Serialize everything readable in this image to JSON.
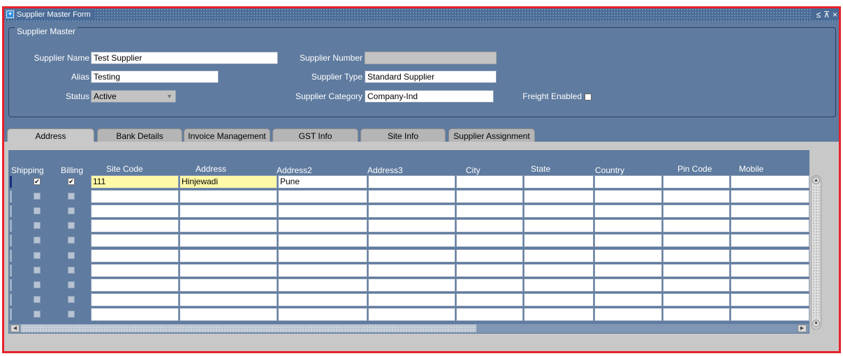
{
  "window": {
    "title": "Supplier Master Form",
    "controls": [
      "≤",
      "⊼",
      "×"
    ]
  },
  "supplier_master": {
    "legend": "Supplier Master",
    "fields": {
      "supplier_name": {
        "label": "Supplier Name",
        "value": "Test Supplier"
      },
      "alias": {
        "label": "Alias",
        "value": "Testing"
      },
      "status": {
        "label": "Status",
        "value": "Active"
      },
      "supplier_number": {
        "label": "Supplier Number",
        "value": ""
      },
      "supplier_type": {
        "label": "Supplier Type",
        "value": "Standard Supplier"
      },
      "supplier_category": {
        "label": "Supplier Category",
        "value": "Company-Ind"
      },
      "freight_enabled": {
        "label": "Freight Enabled",
        "checked": false
      }
    }
  },
  "tabs": [
    {
      "label": "Address",
      "active": true
    },
    {
      "label": "Bank Details",
      "active": false
    },
    {
      "label": "Invoice Management",
      "active": false
    },
    {
      "label": "GST Info",
      "active": false
    },
    {
      "label": "Site Info",
      "active": false
    },
    {
      "label": "Supplier Assignment",
      "active": false
    }
  ],
  "address_grid": {
    "columns": {
      "shipping": "Shipping",
      "billing": "Billing",
      "site_code": "Site Code",
      "address": "Address",
      "address2": "Address2",
      "address3": "Address3",
      "city": "City",
      "state": "State",
      "country": "Country",
      "pin_code": "Pin Code",
      "mobile": "Mobile"
    },
    "rows": [
      {
        "shipping": true,
        "billing": true,
        "site_code": "111",
        "address": "Hinjewadi",
        "address2": "Pune",
        "address3": "",
        "city": "",
        "state": "",
        "country": "",
        "pin_code": "",
        "mobile": ""
      },
      {
        "shipping": false,
        "billing": false,
        "site_code": "",
        "address": "",
        "address2": "",
        "address3": "",
        "city": "",
        "state": "",
        "country": "",
        "pin_code": "",
        "mobile": ""
      },
      {
        "shipping": false,
        "billing": false,
        "site_code": "",
        "address": "",
        "address2": "",
        "address3": "",
        "city": "",
        "state": "",
        "country": "",
        "pin_code": "",
        "mobile": ""
      },
      {
        "shipping": false,
        "billing": false,
        "site_code": "",
        "address": "",
        "address2": "",
        "address3": "",
        "city": "",
        "state": "",
        "country": "",
        "pin_code": "",
        "mobile": ""
      },
      {
        "shipping": false,
        "billing": false,
        "site_code": "",
        "address": "",
        "address2": "",
        "address3": "",
        "city": "",
        "state": "",
        "country": "",
        "pin_code": "",
        "mobile": ""
      },
      {
        "shipping": false,
        "billing": false,
        "site_code": "",
        "address": "",
        "address2": "",
        "address3": "",
        "city": "",
        "state": "",
        "country": "",
        "pin_code": "",
        "mobile": ""
      },
      {
        "shipping": false,
        "billing": false,
        "site_code": "",
        "address": "",
        "address2": "",
        "address3": "",
        "city": "",
        "state": "",
        "country": "",
        "pin_code": "",
        "mobile": ""
      },
      {
        "shipping": false,
        "billing": false,
        "site_code": "",
        "address": "",
        "address2": "",
        "address3": "",
        "city": "",
        "state": "",
        "country": "",
        "pin_code": "",
        "mobile": ""
      },
      {
        "shipping": false,
        "billing": false,
        "site_code": "",
        "address": "",
        "address2": "",
        "address3": "",
        "city": "",
        "state": "",
        "country": "",
        "pin_code": "",
        "mobile": ""
      },
      {
        "shipping": false,
        "billing": false,
        "site_code": "",
        "address": "",
        "address2": "",
        "address3": "",
        "city": "",
        "state": "",
        "country": "",
        "pin_code": "",
        "mobile": ""
      }
    ]
  },
  "icons": {
    "app": "form-app-icon",
    "scroll_left": "scroll-left-icon",
    "scroll_right": "scroll-right-icon",
    "scroll_up": "scroll-up-icon",
    "scroll_down": "scroll-down-icon",
    "dropdown": "chevron-down-icon"
  },
  "colors": {
    "form_background": "#5f7b9f",
    "title_bar": "#4a6b96",
    "window_border": "#e8212a",
    "highlight_cell": "#fff9a8"
  }
}
